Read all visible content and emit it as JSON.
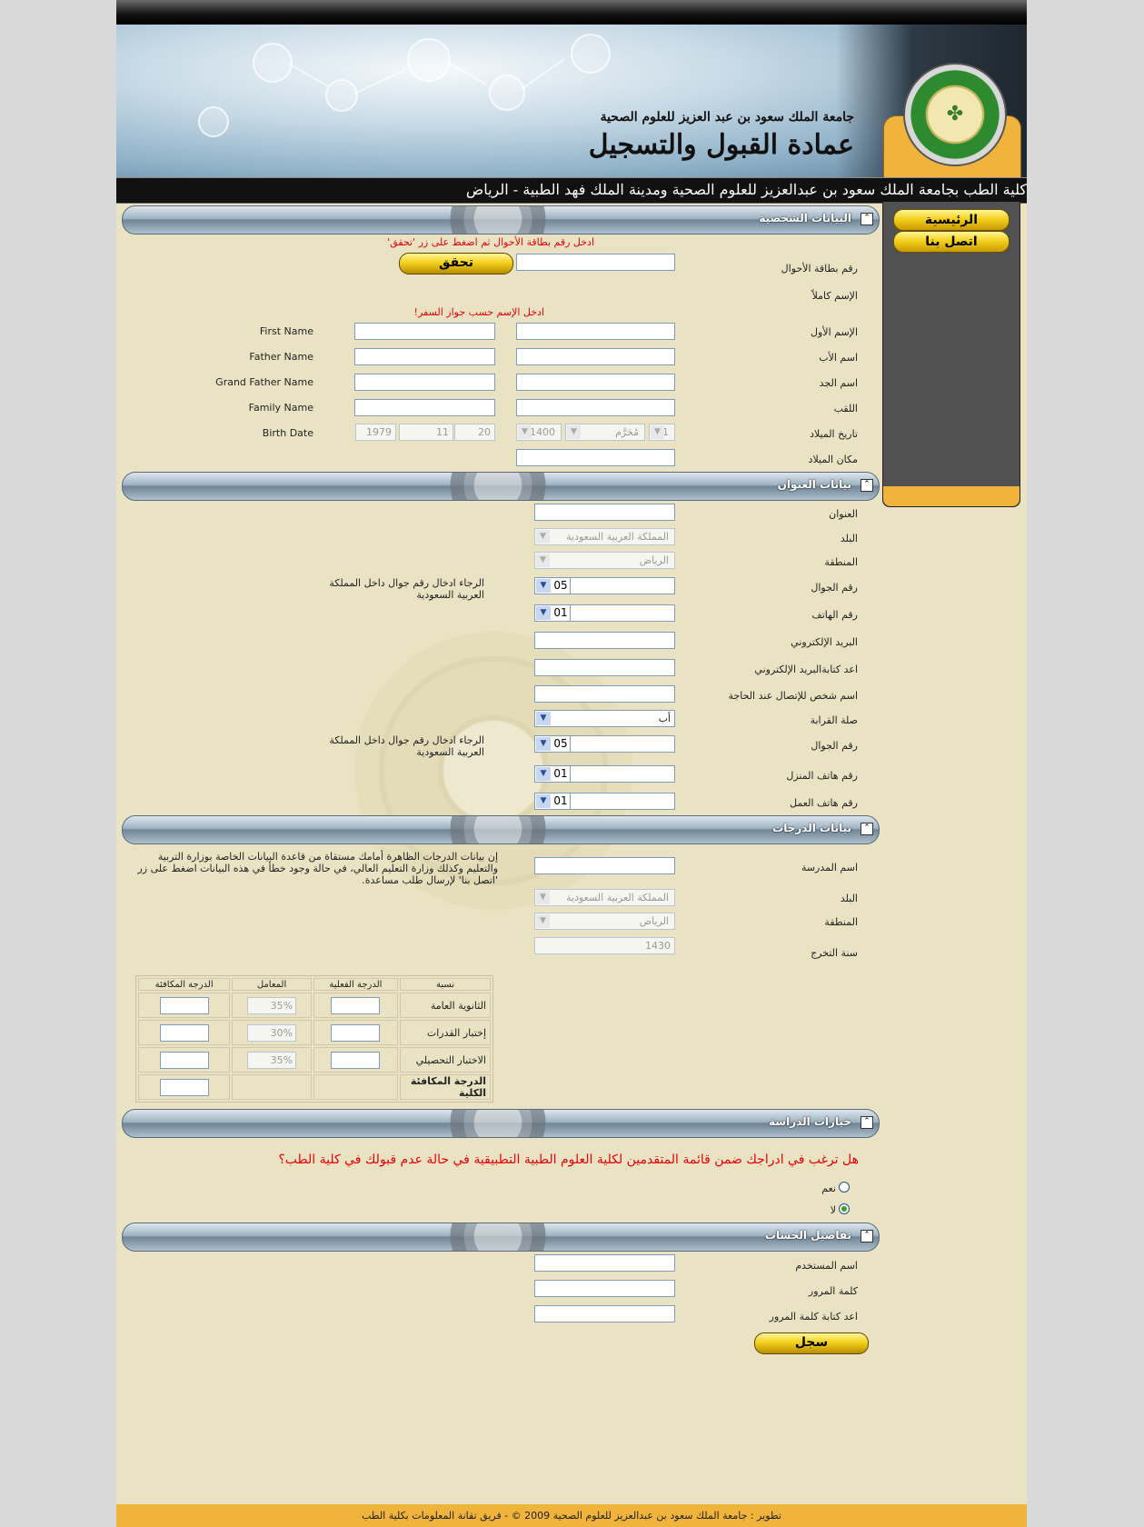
{
  "header": {
    "university": "جامعة الملك سعود بن عبد العزيز للعلوم الصحية",
    "deanship": "عمادة القبول والتسجيل",
    "logo_icon": "university-seal-icon",
    "ticker": "كلية الطب بجامعة الملك سعود بن عبدالعزيز للعلوم الصحية ومدينة الملك فهد الطبية - الرياض"
  },
  "sidebar": {
    "home": "الرئيسية",
    "contact": "اتصل بنا"
  },
  "colors": {
    "accent": "#f0b43c",
    "background": "#e9e3c4",
    "error": "#e8000a"
  },
  "personal": {
    "section_title": "البيانات الشخصية",
    "id_hint": "ادخل رقم بطاقة الأحوال ثم اضغط على زر 'تحقق'",
    "id_label": "رقم بطاقة الأحوال",
    "verify_button": "تحقق",
    "fullname_label": "الإسم كاملاً",
    "passport_hint": "ادخل الإسم حسب جواز السفر!",
    "first_name_ar": "الإسم الأول",
    "father_name_ar": "اسم الأب",
    "grandfather_name_ar": "اسم الجد",
    "family_name_ar": "اللقب",
    "birth_date_ar": "تاريخ الميلاد",
    "birth_place_ar": "مكان الميلاد",
    "first_name_en": "First Name",
    "father_name_en": "Father Name",
    "grandfather_name_en": "Grand Father Name",
    "family_name_en": "Family Name",
    "birth_date_en": "Birth Date",
    "hijri_day": "1",
    "hijri_month": "مُحَرَّم",
    "hijri_year": "1400",
    "greg_year": "1979",
    "greg_month": "11",
    "greg_day": "20"
  },
  "address": {
    "section_title": "بيانات العنوان",
    "address_label": "العنوان",
    "country_label": "البلد",
    "country_value": "المملكة العربية السعودية",
    "region_label": "المنطقة",
    "region_value": "الرياض",
    "mobile_label": "رقم الجوال",
    "mobile_code": "05",
    "mobile_hint": "الرجاء ادخال رقم جوال داخل المملكة العربية السعودية",
    "phone_label": "رقم الهاتف",
    "phone_code": "01",
    "email_label": "البريد الإلكتروني",
    "email_confirm_label": "اعد كتابةالبريد الإلكتروني",
    "emergency_label": "اسم شخص للإتصال عند الحاجة",
    "relation_label": "صلة القرابة",
    "relation_value": "أب",
    "emergency_mobile_label": "رقم الجوال",
    "emergency_mobile_code": "05",
    "emergency_mobile_hint": "الرجاء ادخال رقم جوال داخل المملكة العربية السعودية",
    "home_phone_label": "رقم هاتف المنزل",
    "home_phone_code": "01",
    "work_phone_label": "رقم هاتف العمل",
    "work_phone_code": "01"
  },
  "grades": {
    "section_title": "بيانات الدرجات",
    "note": "إن بيانات الدرجات الظاهرة أمامك مستقاة من قاعدة البيانات الخاصة بوزارة التربية والتعليم وكذلك وزارة التعليم العالي، في حالة وجود خطأ في هذه البيانات اضغط على زر 'اتصل بنا' لإرسال طلب مساعدة.",
    "school_label": "اسم المدرسة",
    "country_label": "البلد",
    "country_value": "المملكة العربية السعودية",
    "region_label": "المنطقة",
    "region_value": "الرياض",
    "grad_year_label": "سنة التخرج",
    "grad_year_value": "1430",
    "table_headers": [
      "نسبة",
      "الدرجة الفعلية",
      "المعامل",
      "الدرجة المكافئة"
    ],
    "rows": [
      {
        "name": "الثانوية العامة",
        "weight": "35%"
      },
      {
        "name": "إختبار القدرات",
        "weight": "30%"
      },
      {
        "name": "الاختبار التحصيلي",
        "weight": "35%"
      }
    ],
    "total_label": "الدرجة المكافئة الكلية"
  },
  "study": {
    "section_title": "خيارات الدراسة",
    "question": "هل ترغب في ادراجك ضمن قائمة المتقدمين لكلية العلوم الطبية التطبيقية في حالة عدم قبولك في كلية الطب؟",
    "yes": "نعم",
    "no": "لا"
  },
  "account": {
    "section_title": "تفاصيل الحساب",
    "username_label": "اسم المستخدم",
    "password_label": "كلمة المرور",
    "password_confirm_label": "اعد كتابة كلمة المرور",
    "register_button": "سجل"
  },
  "footer": {
    "text": "تطوير : جامعة الملك سعود بن عبدالعزيز للعلوم الصحية 2009 © - فريق تقانة المعلومات بكلية الطب"
  }
}
